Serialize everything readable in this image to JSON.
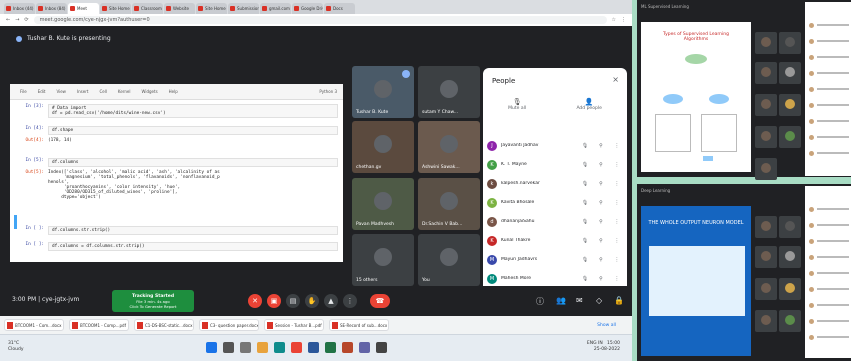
{
  "browser": {
    "tabs": [
      {
        "label": "Inbox (44)",
        "active": false
      },
      {
        "label": "Inbox (84)",
        "active": false
      },
      {
        "label": "Meet",
        "active": true
      },
      {
        "label": "Site Home",
        "active": false
      },
      {
        "label": "Classroom",
        "active": false
      },
      {
        "label": "Website",
        "active": false
      },
      {
        "label": "Site Home",
        "active": false
      },
      {
        "label": "Submission",
        "active": false
      },
      {
        "label": "gmail.com",
        "active": false
      },
      {
        "label": "Google Drive",
        "active": false
      },
      {
        "label": "Docs",
        "active": false
      }
    ],
    "url": "meet.google.com/cye-njgx-jvm?authuser=0"
  },
  "meet": {
    "presenting_text": "Tushar B. Kute is presenting",
    "meeting_code": "cye-jgtx-jvm",
    "time": "3:00 PM",
    "attendance_notice": {
      "title": "Tracking Started",
      "line2": "File 3 min. 4s ago",
      "line3": "Click To Generate Report"
    }
  },
  "jupyter": {
    "menu": [
      "File",
      "Edit",
      "View",
      "Insert",
      "Cell",
      "Kernel",
      "Widgets",
      "Help"
    ],
    "kernel": "Python 3",
    "cells": [
      {
        "prompt": "In [3]:",
        "type": "in",
        "code": "# Data import\ndf = pd.read_csv('/home/dits/wine-new.csv')"
      },
      {
        "prompt": "In [4]:",
        "type": "in",
        "code": "df.shape"
      },
      {
        "prompt": "Out[4]:",
        "type": "out",
        "code": "(178, 14)"
      },
      {
        "prompt": "In [5]:",
        "type": "in",
        "code": "df.columns"
      },
      {
        "prompt": "Out[5]:",
        "type": "out",
        "code": "Index(['class', 'alcohol', 'malic acid', 'ash', 'alcalinity of as\n      'magnesium', 'total_phenols', 'flavanoids', 'nonflavanoid_p\nhenols',\n      'proanthocyanins', 'color intensity', 'hue',\n      'OD280/OD315_of_diluted_wines', 'proline'],\n     dtype='object')"
      },
      {
        "prompt": "In [ ]:",
        "type": "in",
        "code": "df.columns.str.strip()"
      },
      {
        "prompt": "In [ ]:",
        "type": "in",
        "code": "df.columns = df.columns.str.strip()"
      }
    ]
  },
  "tiles": [
    {
      "name": "Tushar B. Kute",
      "color": "#4a5a68",
      "pinned": true
    },
    {
      "name": "sutam Y Chaw...",
      "color": "#3c4043",
      "pinned": false
    },
    {
      "name": "chethan.gv",
      "color": "#5b4a3e",
      "pinned": false
    },
    {
      "name": "Ashwini Sawak...",
      "color": "#6b5a4e",
      "pinned": false
    },
    {
      "name": "Pavan Madhvesh",
      "color": "#4e5a46",
      "pinned": false
    },
    {
      "name": "Dr.Sachin V Bab...",
      "color": "#5a5046",
      "pinned": false
    },
    {
      "name": "15 others",
      "color": "#3c4043",
      "pinned": false
    },
    {
      "name": "You",
      "color": "#3c4043",
      "pinned": false
    }
  ],
  "people": {
    "title": "People",
    "mute_all": "Mute all",
    "add_people": "Add people",
    "list": [
      {
        "name": "Jayavanti Jadhav",
        "initial": "J",
        "color": "#8e24aa"
      },
      {
        "name": "K. T. Mayne",
        "initial": "K",
        "color": "#43a047"
      },
      {
        "name": "kalpesh.narvekar",
        "initial": "k",
        "color": "#6d4c41"
      },
      {
        "name": "Kavita Bhosale",
        "initial": "K",
        "color": "#7cb342"
      },
      {
        "name": "dhananjaiSahu",
        "initial": "d",
        "color": "#795548"
      },
      {
        "name": "Kunal Thakre",
        "initial": "K",
        "color": "#c62828"
      },
      {
        "name": "Mayuri Jadhavrs",
        "initial": "M",
        "color": "#3949ab"
      },
      {
        "name": "Mahesh More",
        "initial": "M",
        "color": "#00897b"
      }
    ]
  },
  "downloads": {
    "items": [
      "BTCOOM1 - Com...docx",
      "BTCOOM1 - Comp...pdf",
      "C1-DS-BSC-static...docx",
      "C3- question paper.docx",
      "Session - Tushar B...pdf",
      "SE-Record of sub...docx"
    ],
    "show_all": "Show all"
  },
  "taskbar": {
    "weather_temp": "31°C",
    "weather_desc": "Cloudy",
    "lang": "ENG IN",
    "time": "15:00",
    "date": "25-08-2022"
  },
  "side_windows": [
    {
      "title": "ML Supervised Learning",
      "slide_heading": "Types of Supervised Learning Algorithms"
    },
    {
      "title": "Deep Learning",
      "slide_heading": "THE WHOLE OUTPUT NEURON MODEL"
    }
  ]
}
